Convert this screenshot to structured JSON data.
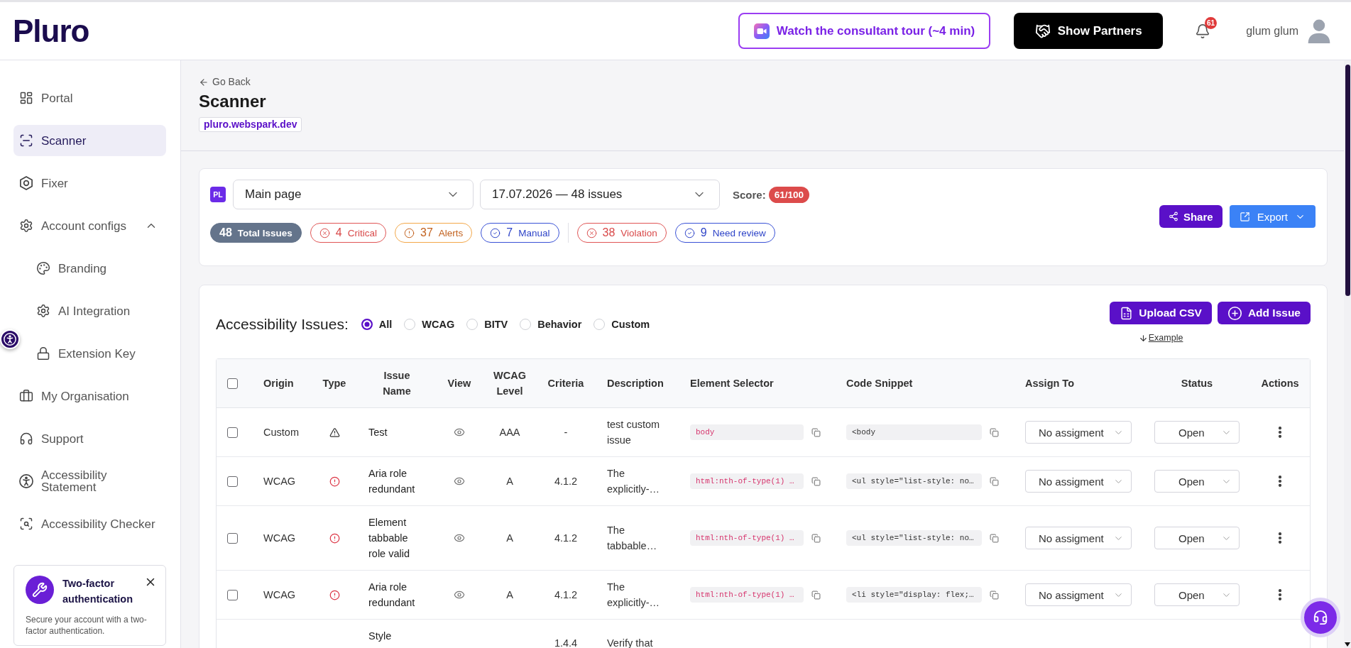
{
  "header": {
    "logo": "Pluro",
    "tour_button": "Watch the consultant tour (~4 min)",
    "partners_button": "Show Partners",
    "notification_count": "61",
    "user_name": "glum glum"
  },
  "sidebar": {
    "items": [
      {
        "label": "Portal",
        "selected": false
      },
      {
        "label": "Scanner",
        "selected": true
      },
      {
        "label": "Fixer",
        "selected": false
      },
      {
        "label": "Account configs",
        "selected": false,
        "expanded": true,
        "children": [
          {
            "label": "Branding",
            "selected": false
          },
          {
            "label": "AI Integration",
            "selected": false
          },
          {
            "label": "Extension Key",
            "selected": false
          }
        ]
      },
      {
        "label": "My Organisation",
        "selected": false
      },
      {
        "label": "Support",
        "selected": false
      },
      {
        "label": "Accessibility Statement",
        "selected": false
      },
      {
        "label": "Accessibility Checker",
        "selected": false
      }
    ],
    "notice": {
      "title": "Two-factor authentication",
      "text": "Secure your account with a two-factor authentication."
    }
  },
  "page": {
    "back_link": "Go Back",
    "title": "Scanner",
    "domain": "pluro.webspark.dev"
  },
  "summary": {
    "site_badge": "PL",
    "page_select": "Main page",
    "scan_select": "17.07.2026 — 48 issues",
    "score_label": "Score:",
    "score": "61/100",
    "chip_groups": [
      [
        {
          "kind": "total",
          "count": "48",
          "label": "Total Issues"
        },
        {
          "kind": "critical",
          "count": "4",
          "label": "Critical"
        },
        {
          "kind": "alert",
          "count": "37",
          "label": "Alerts"
        },
        {
          "kind": "manual",
          "count": "7",
          "label": "Manual"
        }
      ],
      [
        {
          "kind": "violation",
          "count": "38",
          "label": "Violation"
        },
        {
          "kind": "review",
          "count": "9",
          "label": "Need review"
        }
      ]
    ],
    "share_button": "Share",
    "export_button": "Export"
  },
  "issues": {
    "title": "Accessibility Issues:",
    "filters": [
      {
        "label": "All",
        "selected": true
      },
      {
        "label": "WCAG",
        "selected": false
      },
      {
        "label": "BITV",
        "selected": false
      },
      {
        "label": "Behavior",
        "selected": false
      },
      {
        "label": "Custom",
        "selected": false
      }
    ],
    "upload_button": "Upload CSV",
    "add_button": "Add Issue",
    "example_link": "Example",
    "table": {
      "select_all": {
        "checked": false
      },
      "columns": [
        "Origin",
        "Type",
        "Issue Name",
        "View",
        "WCAG Level",
        "Criteria",
        "Description",
        "Element Selector",
        "Code Snippet",
        "Assign To",
        "Status",
        "Actions"
      ],
      "rows": [
        {
          "kind": "full",
          "checked": false,
          "origin": "Custom",
          "type_icon": {
            "kind": "warning"
          },
          "issue_name": "Test",
          "wcag_level": "AAA",
          "criteria": "-",
          "description": "test custom issue",
          "element_selector": "body",
          "code_snippet": "<body",
          "assign_to": "No assigment",
          "status": "Open"
        },
        {
          "kind": "full",
          "checked": false,
          "origin": "WCAG",
          "type_icon": {
            "kind": "error"
          },
          "issue_name": "Aria role redundant",
          "wcag_level": "A",
          "criteria": "4.1.2",
          "description": "The explicitly-…",
          "element_selector": "html:nth-of-type(1) …",
          "code_snippet": "<ul style=\"list-style: no…",
          "assign_to": "No assigment",
          "status": "Open"
        },
        {
          "kind": "full",
          "checked": false,
          "origin": "WCAG",
          "type_icon": {
            "kind": "error"
          },
          "issue_name": "Element tabbable role valid",
          "wcag_level": "A",
          "criteria": "4.1.2",
          "description": "The tabbable…",
          "element_selector": "html:nth-of-type(1) …",
          "code_snippet": "<ul style=\"list-style: no…",
          "assign_to": "No assigment",
          "status": "Open"
        },
        {
          "kind": "full",
          "checked": false,
          "origin": "WCAG",
          "type_icon": {
            "kind": "error"
          },
          "issue_name": "Aria role redundant",
          "wcag_level": "A",
          "criteria": "4.1.2",
          "description": "The explicitly-…",
          "element_selector": "html:nth-of-type(1) …",
          "code_snippet": "<li style=\"display: flex;…",
          "assign_to": "No assigment",
          "status": "Open"
        },
        {
          "kind": "clipped",
          "issue_name": "Style",
          "criteria": "1.4.4",
          "description": "Verify that"
        }
      ]
    }
  }
}
